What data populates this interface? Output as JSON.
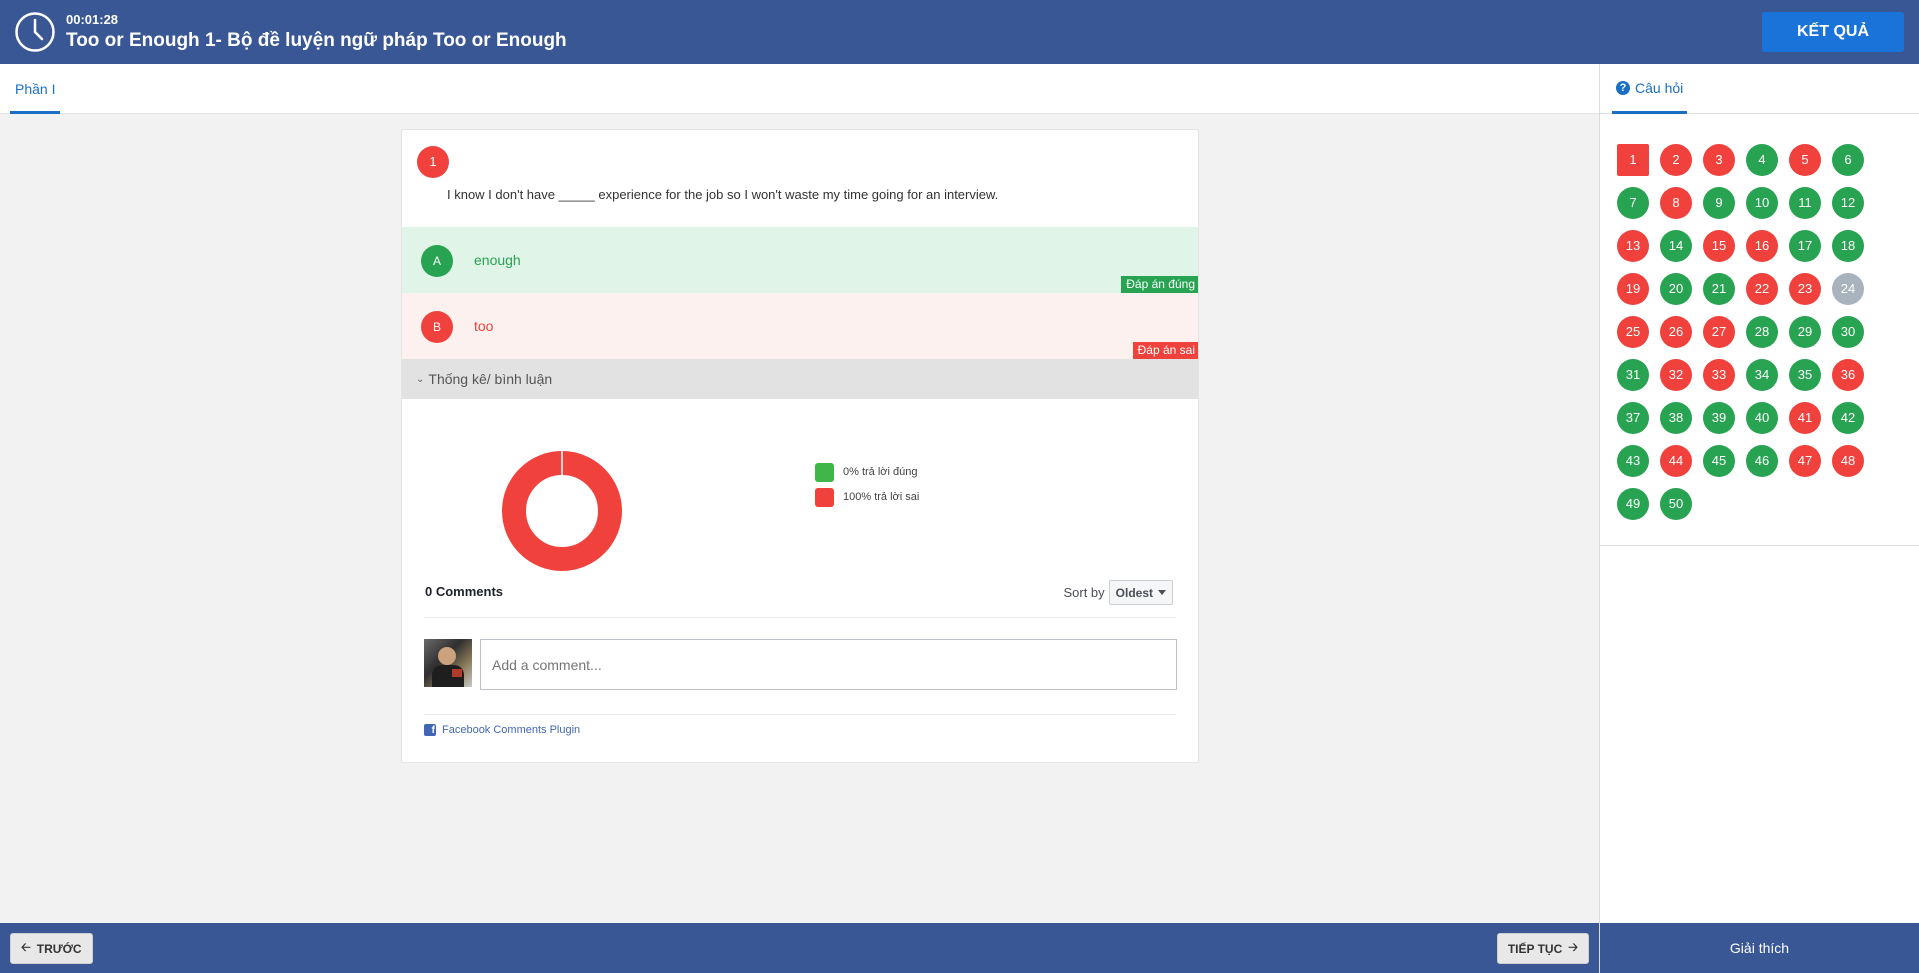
{
  "header": {
    "timer": "00:01:28",
    "title": "Too or Enough 1- Bộ đề luyện ngữ pháp Too or Enough",
    "result_button": "KẾT QUẢ"
  },
  "tabs": {
    "part": "Phần I",
    "questions": "Câu hỏi"
  },
  "question": {
    "number": "1",
    "text": "I know I don't have _____ experience for the job so I won't waste my time going for an interview.",
    "options": [
      {
        "letter": "A",
        "text": "enough",
        "badge": "Đáp án đúng",
        "state": "correct"
      },
      {
        "letter": "B",
        "text": "too",
        "badge": "Đáp án sai",
        "state": "wrong"
      }
    ]
  },
  "stats": {
    "toggle_label": "Thống kê/ bình luận",
    "correct_label": "0% trả lời đúng",
    "wrong_label": "100% trả lời sai",
    "correct_percent": 0,
    "wrong_percent": 100,
    "correct_color": "#3fb54a",
    "wrong_color": "#f0413c"
  },
  "comments": {
    "count_label": "0 Comments",
    "sort_by": "Sort by",
    "sort_value": "Oldest",
    "placeholder": "Add a comment...",
    "plugin_label": "Facebook Comments Plugin"
  },
  "question_grid": [
    {
      "n": "1",
      "s": "current"
    },
    {
      "n": "2",
      "s": "wrong"
    },
    {
      "n": "3",
      "s": "wrong"
    },
    {
      "n": "4",
      "s": "correct"
    },
    {
      "n": "5",
      "s": "wrong"
    },
    {
      "n": "6",
      "s": "correct"
    },
    {
      "n": "7",
      "s": "correct"
    },
    {
      "n": "8",
      "s": "wrong"
    },
    {
      "n": "9",
      "s": "correct"
    },
    {
      "n": "10",
      "s": "correct"
    },
    {
      "n": "11",
      "s": "correct"
    },
    {
      "n": "12",
      "s": "correct"
    },
    {
      "n": "13",
      "s": "wrong"
    },
    {
      "n": "14",
      "s": "correct"
    },
    {
      "n": "15",
      "s": "wrong"
    },
    {
      "n": "16",
      "s": "wrong"
    },
    {
      "n": "17",
      "s": "correct"
    },
    {
      "n": "18",
      "s": "correct"
    },
    {
      "n": "19",
      "s": "wrong"
    },
    {
      "n": "20",
      "s": "correct"
    },
    {
      "n": "21",
      "s": "correct"
    },
    {
      "n": "22",
      "s": "wrong"
    },
    {
      "n": "23",
      "s": "wrong"
    },
    {
      "n": "24",
      "s": "empty"
    },
    {
      "n": "25",
      "s": "wrong"
    },
    {
      "n": "26",
      "s": "wrong"
    },
    {
      "n": "27",
      "s": "wrong"
    },
    {
      "n": "28",
      "s": "correct"
    },
    {
      "n": "29",
      "s": "correct"
    },
    {
      "n": "30",
      "s": "correct"
    },
    {
      "n": "31",
      "s": "correct"
    },
    {
      "n": "32",
      "s": "wrong"
    },
    {
      "n": "33",
      "s": "wrong"
    },
    {
      "n": "34",
      "s": "correct"
    },
    {
      "n": "35",
      "s": "correct"
    },
    {
      "n": "36",
      "s": "wrong"
    },
    {
      "n": "37",
      "s": "correct"
    },
    {
      "n": "38",
      "s": "correct"
    },
    {
      "n": "39",
      "s": "correct"
    },
    {
      "n": "40",
      "s": "correct"
    },
    {
      "n": "41",
      "s": "wrong"
    },
    {
      "n": "42",
      "s": "correct"
    },
    {
      "n": "43",
      "s": "correct"
    },
    {
      "n": "44",
      "s": "wrong"
    },
    {
      "n": "45",
      "s": "correct"
    },
    {
      "n": "46",
      "s": "correct"
    },
    {
      "n": "47",
      "s": "wrong"
    },
    {
      "n": "48",
      "s": "wrong"
    },
    {
      "n": "49",
      "s": "correct"
    },
    {
      "n": "50",
      "s": "correct"
    }
  ],
  "footer": {
    "prev": "TRƯỚC",
    "next": "TIẾP TỤC",
    "explain": "Giải thích"
  },
  "colors": {
    "header_bg": "#3a5795",
    "accent": "#1a6fc4",
    "correct": "#27a352",
    "wrong": "#f0413c",
    "unanswered": "#a8b3bd"
  },
  "icons": {
    "clock": "clock-icon",
    "help": "question-circle-icon",
    "chevron": "chevron-down-icon",
    "prev": "arrow-left-icon",
    "next": "arrow-right-icon",
    "facebook": "facebook-icon"
  }
}
